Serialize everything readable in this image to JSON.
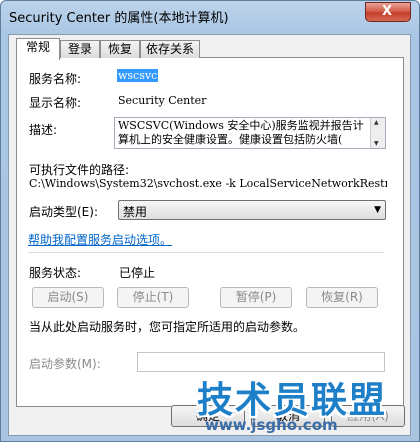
{
  "window": {
    "title": "Security Center 的属性(本地计算机)",
    "close_symbol": "X"
  },
  "tabs": [
    {
      "label": "常规",
      "active": true
    },
    {
      "label": "登录",
      "active": false
    },
    {
      "label": "恢复",
      "active": false
    },
    {
      "label": "依存关系",
      "active": false
    }
  ],
  "general": {
    "service_name_label": "服务名称:",
    "service_name_value": "wscsvc",
    "display_name_label": "显示名称:",
    "display_name_value": "Security Center",
    "description_label": "描述:",
    "description_line1": "WSCSVC(Windows 安全中心)服务监视并报告计",
    "description_line2": "算机上的安全健康设置。健康设置包括防火墙(",
    "exe_path_label": "可执行文件的路径:",
    "exe_path_value": "C:\\Windows\\System32\\svchost.exe -k LocalServiceNetworkRestri",
    "startup_type_label": "启动类型(E):",
    "startup_type_value": "禁用",
    "help_link": "帮助我配置服务启动选项。",
    "service_status_label": "服务状态:",
    "service_status_value": "已停止",
    "start_button": "启动(S)",
    "stop_button": "停止(T)",
    "pause_button": "暂停(P)",
    "resume_button": "恢复(R)",
    "hint_text": "当从此处启动服务时，您可指定所适用的启动参数。",
    "start_params_label": "启动参数(M):",
    "start_params_value": ""
  },
  "footer": {
    "ok_button": "确定",
    "cancel_button": "取消",
    "apply_button": "应用(A)"
  },
  "watermark": {
    "text_cn": "技术员联盟",
    "text_url": "www.jsgho.com"
  },
  "colors": {
    "selection": "#3399ff",
    "link": "#0066cc",
    "watermark": "#1c7fc7"
  }
}
